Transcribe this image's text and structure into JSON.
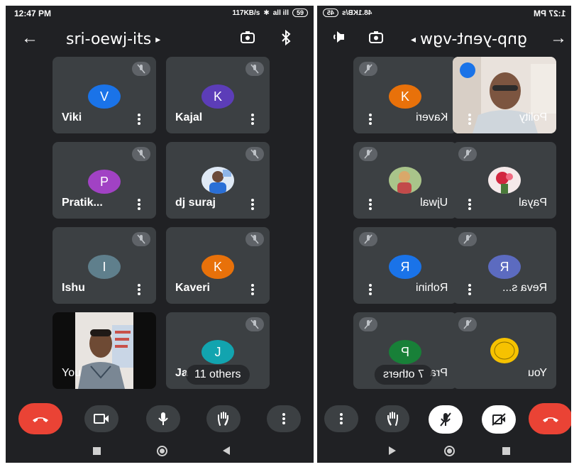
{
  "left_screen": {
    "status_bar": {
      "time": "12:47 PM",
      "net_speed": "117KB/s",
      "signal": "all ill",
      "battery": "59"
    },
    "header": {
      "title": "sri-oewj-its"
    },
    "participants": [
      {
        "name": "Viki",
        "initial": "V",
        "color": "#1a73e8",
        "type": "initial",
        "muted": true
      },
      {
        "name": "Kajal",
        "initial": "K",
        "color": "#5c3db8",
        "type": "initial",
        "muted": true
      },
      {
        "name": "Pratik...",
        "initial": "P",
        "color": "#a142c4",
        "type": "initial",
        "muted": true
      },
      {
        "name": "dj suraj",
        "type": "photo",
        "muted": true
      },
      {
        "name": "Ishu",
        "initial": "I",
        "color": "#5f7f8c",
        "type": "initial",
        "muted": true
      },
      {
        "name": "Kaveri",
        "initial": "K",
        "color": "#e8710a",
        "type": "initial",
        "muted": true
      },
      {
        "name": "You",
        "type": "video",
        "muted": false
      },
      {
        "name": "Ja",
        "initial": "J",
        "color": "#12a4af",
        "type": "initial",
        "muted": true,
        "others": "11 others"
      }
    ]
  },
  "right_screen": {
    "status_bar": {
      "time": "1:27 PM",
      "net_speed": "48.1KB/s",
      "battery": "45"
    },
    "header": {
      "title": "gnp-yent-vgw"
    },
    "participants": [
      {
        "name": "Kaveri",
        "initial": "K",
        "color": "#e8710a",
        "type": "initial",
        "muted": true
      },
      {
        "name": "Polity",
        "type": "video",
        "muted": false
      },
      {
        "name": "Ujwal",
        "type": "photo",
        "muted": true
      },
      {
        "name": "Payal",
        "type": "photo2",
        "muted": true
      },
      {
        "name": "Rohini",
        "initial": "R",
        "color": "#1a73e8",
        "type": "initial",
        "muted": true
      },
      {
        "name": "Reva s...",
        "initial": "R",
        "color": "#5c6bc0",
        "type": "initial",
        "muted": true
      },
      {
        "name": "Pra",
        "initial": "P",
        "color": "#188038",
        "type": "initial",
        "muted": true,
        "others": "7 others"
      },
      {
        "name": "You",
        "type": "logo",
        "muted": true
      }
    ]
  },
  "colors": {
    "background": "#202124",
    "tile": "#3c4043",
    "hangup": "#ea4335"
  },
  "icons": [
    "arrow-back-icon",
    "chevron-right-icon",
    "switch-camera-icon",
    "bluetooth-icon",
    "speaker-icon",
    "mic-off-icon",
    "more-vert-icon",
    "hangup-icon",
    "video-icon",
    "video-off-icon",
    "mic-icon",
    "raise-hand-icon"
  ]
}
